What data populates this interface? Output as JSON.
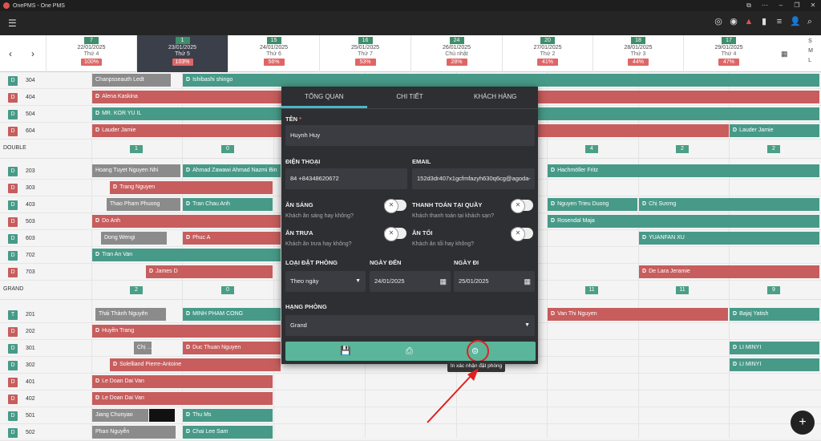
{
  "window": {
    "title": "OnePMS - One PMS"
  },
  "dates": [
    {
      "count": "7",
      "date": "22/01/2025",
      "weekday": "Thứ 4",
      "pct": "100%"
    },
    {
      "count": "1",
      "date": "23/01/2025",
      "weekday": "Thứ 5",
      "pct": "103%"
    },
    {
      "count": "15",
      "date": "24/01/2025",
      "weekday": "Thứ 6",
      "pct": "56%"
    },
    {
      "count": "16",
      "date": "25/01/2025",
      "weekday": "Thứ 7",
      "pct": "53%"
    },
    {
      "count": "24",
      "date": "26/01/2025",
      "weekday": "Chủ nhật",
      "pct": "28%"
    },
    {
      "count": "20",
      "date": "27/01/2025",
      "weekday": "Thứ 2",
      "pct": "41%"
    },
    {
      "count": "18",
      "date": "28/01/2025",
      "weekday": "Thứ 3",
      "pct": "44%"
    },
    {
      "count": "17",
      "date": "29/01/2025",
      "weekday": "Thứ 4",
      "pct": "47%"
    }
  ],
  "view_sizes": {
    "s": "S",
    "m": "M",
    "l": "L"
  },
  "sections": {
    "double": {
      "label": "DOUBLE",
      "counts": [
        "1",
        "0",
        "4",
        "2",
        "2"
      ]
    },
    "grand": {
      "label": "GRAND",
      "counts": [
        "2",
        "0",
        "11",
        "11",
        "9"
      ]
    }
  },
  "rooms": {
    "r304": {
      "tag": "D",
      "num": "304"
    },
    "r404": {
      "tag": "D",
      "num": "404"
    },
    "r504": {
      "tag": "D",
      "num": "504"
    },
    "r604": {
      "tag": "D",
      "num": "604"
    },
    "r203": {
      "tag": "D",
      "num": "203"
    },
    "r303": {
      "tag": "D",
      "num": "303"
    },
    "r403": {
      "tag": "D",
      "num": "403"
    },
    "r503": {
      "tag": "D",
      "num": "503"
    },
    "r603": {
      "tag": "D",
      "num": "603"
    },
    "r702": {
      "tag": "D",
      "num": "702"
    },
    "r703": {
      "tag": "D",
      "num": "703"
    },
    "r201": {
      "tag": "T",
      "num": "201"
    },
    "r202": {
      "tag": "D",
      "num": "202"
    },
    "r301": {
      "tag": "D",
      "num": "301"
    },
    "r302": {
      "tag": "D",
      "num": "302"
    },
    "r401": {
      "tag": "D",
      "num": "401"
    },
    "r402": {
      "tag": "D",
      "num": "402"
    },
    "r501": {
      "tag": "D",
      "num": "501"
    },
    "r502": {
      "tag": "D",
      "num": "502"
    }
  },
  "bookings": {
    "b1": "Chanpsseauth Ledt",
    "b2": "Ishibashi shingo",
    "b3": "Alena Kaskina",
    "b4": "MR. KOR YU IL",
    "b5": "Lauder Jamie",
    "b6": "Lauder Jamie",
    "b7": "Hoang Tuyet Nguyen Nhi",
    "b8": "Ahmad Zawawi Ahmad Nazmi Bin",
    "b9": "Hachmöller Fritz",
    "b10": "Trang Nguyen",
    "b11": "Thao Pham Phuong",
    "b12": "Tran Chau Anh",
    "b13": "Nguyen Trieu Duong",
    "b14": "Chị Sương",
    "b15": "Do Anh",
    "b16": "Rosendal Maja",
    "b17": "Dong Wengi",
    "b18": "Phuc A",
    "b19": "YUANFAN XU",
    "b20": "Tran An Van",
    "b21": "James D",
    "b22": "De Lara Jeramie",
    "b23": "Thái Thành Nguyên",
    "b24": "MINH PHAM CONG",
    "b25": "Van Thi Nguyen",
    "b26": "Bajaj Yatish",
    "b27": "Huyền Trang",
    "b28": "Chị ...",
    "b29": "Duc Thuan Nguyen",
    "b30": "LI MINYI",
    "b31": "Solelliand Pierre-Antoine",
    "b32": "LI MINYI",
    "b33": "Le Doan Dai Van",
    "b34": "Le Doan Dai Van",
    "b35": "Jiang Chunyao",
    "b36": "Thu Ms",
    "b37": "Phan Nguyễn",
    "b38": "Chai Lee Sam"
  },
  "modal": {
    "tabs": [
      "TỔNG QUAN",
      "CHI TIẾT",
      "KHÁCH HÀNG"
    ],
    "name_label": "TÊN",
    "name_required": "*",
    "name_value": "Huynh Huy",
    "phone_label": "ĐIỆN THOẠI",
    "phone_value": "84 +84348620672",
    "email_label": "EMAIL",
    "email_value": "152d3dr407x1gcfmfazyh630q6cg@agoda-",
    "breakfast_label": "ĂN SÁNG",
    "breakfast_sub": "Khách ăn sáng hay không?",
    "counter_pay_label": "THANH TOÁN TẠI QUẦY",
    "counter_pay_sub": "Khách thanh toán tại khách sạn?",
    "lunch_label": "ĂN TRƯA",
    "lunch_sub": "Khách ăn trưa hay không?",
    "dinner_label": "ĂN TỐI",
    "dinner_sub": "Khách ăn tối hay không?",
    "booking_type_label": "LOẠI ĐẶT PHÒNG",
    "booking_type_value": "Theo ngày",
    "arrival_label": "NGÀY ĐẾN",
    "arrival_value": "24/01/2025",
    "departure_label": "NGÀY ĐI",
    "departure_value": "25/01/2025",
    "room_class_label": "HẠNG PHÒNG",
    "room_class_value": "Grand"
  },
  "tooltip": "In xác nhận đặt phòng",
  "colors": {
    "teal": "#479a88",
    "red": "#c75d5d",
    "gray": "#8b8b8b",
    "modal": "#2d2f33",
    "accent": "#5ab59a"
  }
}
